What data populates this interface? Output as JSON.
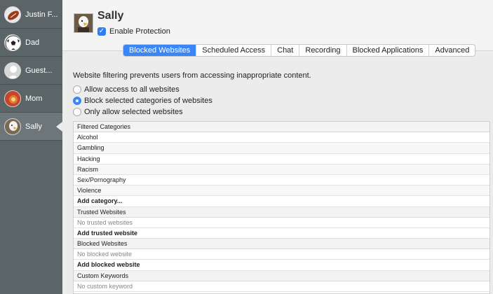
{
  "sidebar": {
    "users": [
      {
        "name": "Justin F...",
        "icon": "football-avatar-icon"
      },
      {
        "name": "Dad",
        "icon": "soccer-ball-avatar-icon"
      },
      {
        "name": "Guest...",
        "icon": "generic-person-avatar-icon"
      },
      {
        "name": "Mom",
        "icon": "flower-avatar-icon"
      },
      {
        "name": "Sally",
        "icon": "eagle-avatar-icon",
        "selected": true
      }
    ]
  },
  "header": {
    "title": "Sally",
    "enable_protection_label": "Enable Protection",
    "enable_protection_checked": true
  },
  "tabs": [
    {
      "label": "Blocked Websites",
      "active": true
    },
    {
      "label": "Scheduled Access"
    },
    {
      "label": "Chat"
    },
    {
      "label": "Recording"
    },
    {
      "label": "Blocked Applications"
    },
    {
      "label": "Advanced"
    }
  ],
  "content": {
    "description": "Website filtering prevents users from accessing inappropriate content.",
    "options": [
      {
        "label": "Allow access to all websites",
        "selected": false
      },
      {
        "label": "Block selected categories of websites",
        "selected": true
      },
      {
        "label": "Only allow selected websites",
        "selected": false
      }
    ]
  },
  "list": {
    "filtered_header": "Filtered Categories",
    "categories": [
      "Alcohol",
      "Gambling",
      "Hacking",
      "Racism",
      "Sex/Pornography",
      "Violence"
    ],
    "add_category": "Add category...",
    "trusted_header": "Trusted Websites",
    "trusted_empty": "No trusted websites",
    "add_trusted": "Add trusted website",
    "blocked_header": "Blocked Websites",
    "blocked_empty": "No blocked website",
    "add_blocked": "Add blocked website",
    "keywords_header": "Custom Keywords",
    "keywords_empty": "No custom keyword"
  },
  "colors": {
    "sidebar_bg": "#5b6466",
    "accent": "#3b86f6"
  }
}
